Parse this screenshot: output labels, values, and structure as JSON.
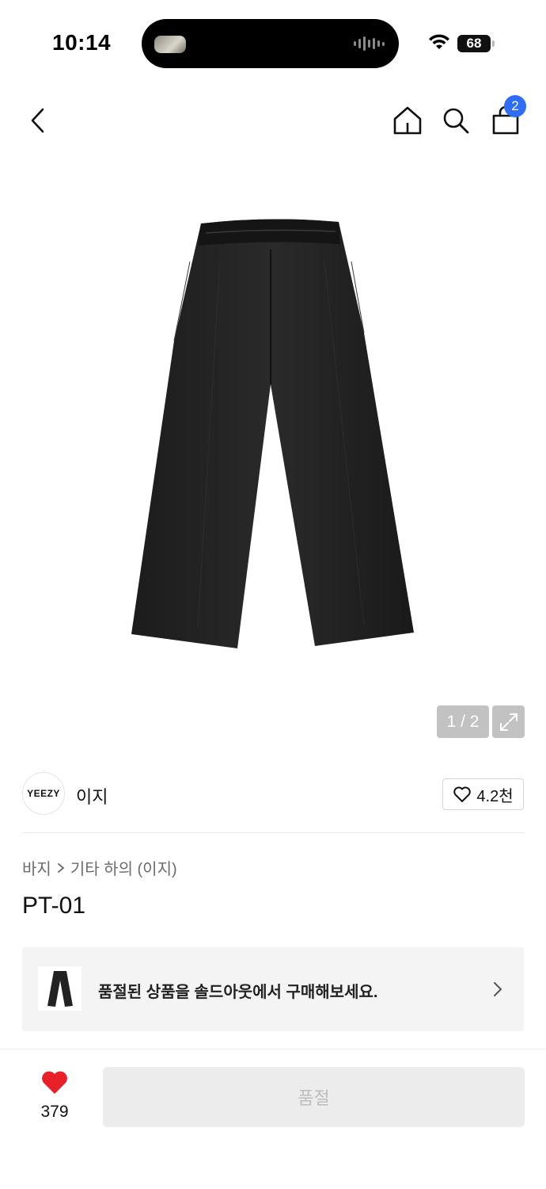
{
  "status_bar": {
    "time": "10:14",
    "battery": "68"
  },
  "nav": {
    "back_icon": "chevron-left-icon",
    "home_icon": "home-icon",
    "search_icon": "search-icon",
    "cart_icon": "shopping-bag-icon",
    "cart_count": "2"
  },
  "gallery": {
    "page_indicator": "1 / 2",
    "expand_icon": "expand-icon"
  },
  "brand": {
    "logo_text": "YEEZY",
    "name": "이지",
    "like_count": "4.2천"
  },
  "breadcrumb": {
    "category": "바지",
    "subcategory": "기타 하의 (이지)"
  },
  "product": {
    "title": "PT-01"
  },
  "soldout_card": {
    "text": "품절된 상품을 솔드아웃에서 구매해보세요."
  },
  "bottom_bar": {
    "wishlist_count": "379",
    "buy_label": "품절"
  },
  "colors": {
    "badge": "#2f6df6",
    "heart": "#e8202a",
    "disabled_btn": "#ececec"
  }
}
